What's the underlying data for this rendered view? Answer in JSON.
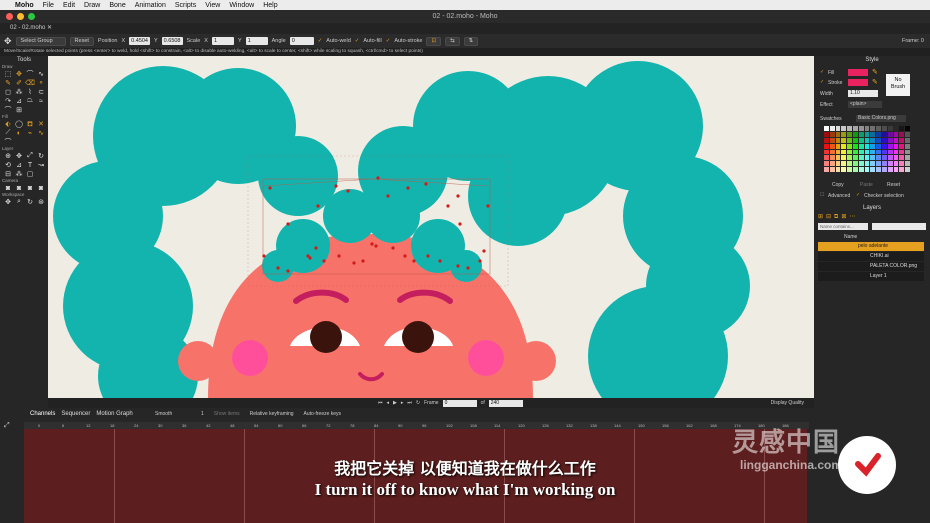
{
  "menubar": {
    "app": "Moho",
    "items": [
      "File",
      "Edit",
      "Draw",
      "Bone",
      "Animation",
      "Scripts",
      "View",
      "Window",
      "Help"
    ]
  },
  "window": {
    "title": "02 - 02.moho - Moho",
    "doc_tab": "02 - 02.moho ✕"
  },
  "tool_options": {
    "group": "Select Group",
    "reset": "Reset",
    "position_label": "Position",
    "x_label": "X",
    "x_value": "0.4504",
    "y_label": "Y",
    "y_value": "0.6508",
    "scale_label": "Scale",
    "sx_label": "X",
    "sx_value": "1",
    "sy_label": "Y",
    "sy_value": "1",
    "angle_label": "Angle",
    "angle_value": "0",
    "auto_weld": "Auto-weld",
    "auto_fill": "Auto-fill",
    "auto_stroke": "Auto-stroke",
    "frame": "Frame: 0"
  },
  "hint": "Move/Scale/Rotate selected points (press <enter> to weld, hold <shift> to constrain, <alt> to disable auto-welding, <alt> to scale to center, <shift> while scaling to squash, <ctrl/cmd> to select points)",
  "tools": {
    "title": "Tools",
    "sections": [
      "Draw",
      "Fill",
      "Layer",
      "Camera",
      "Workspace"
    ]
  },
  "style_panel": {
    "title": "Style",
    "fill": "Fill",
    "stroke": "Stroke",
    "width": "Width",
    "width_value": "1.10",
    "effect": "Effect",
    "effect_value": "<plain>",
    "no_brush": "No\nBrush",
    "swatches": "Swatches",
    "swatch_set": "Basic Colors.png",
    "copy": "Copy",
    "paste": "Paste",
    "reset": "Reset",
    "advanced": "Advanced",
    "checker": "Checker selection",
    "fill_color": "#e8235f",
    "stroke_color": "#e8235f"
  },
  "layers_panel": {
    "title": "Layers",
    "search_placeholder": "Name contains...",
    "name_col": "Name",
    "layers": [
      "pelo adelante",
      "CHIKI.ai",
      "PALETA COLOR.png",
      "Layer 1"
    ]
  },
  "status": {
    "frame_label": "Frame",
    "frame_value": "0",
    "of_label": "of",
    "total": "240",
    "display_quality": "Display Quality"
  },
  "timeline": {
    "tabs": [
      "Channels",
      "Sequencer",
      "Motion Graph"
    ],
    "interp": "Smooth",
    "interp_value": "1",
    "show_items": "Show items",
    "relative": "Relative keyframing",
    "autofreeze": "Auto-freeze keys",
    "ticks": [
      "0",
      "6",
      "12",
      "18",
      "24",
      "30",
      "36",
      "42",
      "48",
      "54",
      "60",
      "66",
      "72",
      "78",
      "84",
      "90",
      "96",
      "102",
      "108",
      "114",
      "120",
      "126",
      "132",
      "138",
      "144",
      "150",
      "156",
      "162",
      "168",
      "174",
      "180",
      "186"
    ]
  },
  "subtitles": {
    "cn": "我把它关掉 以便知道我在做什么工作",
    "en": "I turn it off to know what I'm working on"
  },
  "watermark": {
    "cn": "灵感中国",
    "url": "lingganchina.com"
  },
  "colors": {
    "hair": "#14b4ae",
    "skin": "#f7736a",
    "cheek": "#ff4f9a",
    "brow": "#c41e5e",
    "canvas": "#efede3",
    "track": "#5c1e1e"
  }
}
